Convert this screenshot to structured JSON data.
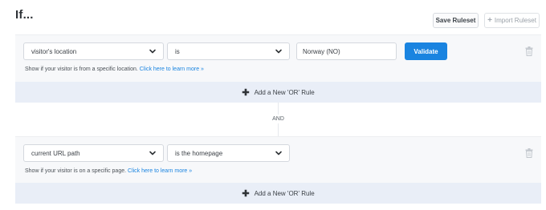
{
  "header": {
    "title": "If...",
    "save_ruleset": "Save Ruleset",
    "import_ruleset": "Import Ruleset",
    "import_icon": "+"
  },
  "rules": [
    {
      "condition": "visitor's location",
      "operator": "is",
      "value": "Norway (NO)",
      "validate_label": "Validate",
      "help_text": "Show if your visitor is from a specific location.",
      "help_link": "Click here to learn more »",
      "or_icon": "✚",
      "or_label": "Add a New 'OR' Rule"
    },
    {
      "condition": "current URL path",
      "operator": "is the homepage",
      "help_text": "Show if your visitor is on a specific page.",
      "help_link": "Click here to learn more »",
      "or_icon": "✚",
      "or_label": "Add a New 'OR' Rule"
    }
  ],
  "connector": {
    "label": "AND"
  },
  "icons": {
    "chevron": "chevron-down-icon",
    "trash": "trash-icon"
  },
  "colors": {
    "accent": "#1a84e0",
    "ruleset_bg": "#f7f8fa",
    "or_bar_bg": "#e9eef7"
  }
}
